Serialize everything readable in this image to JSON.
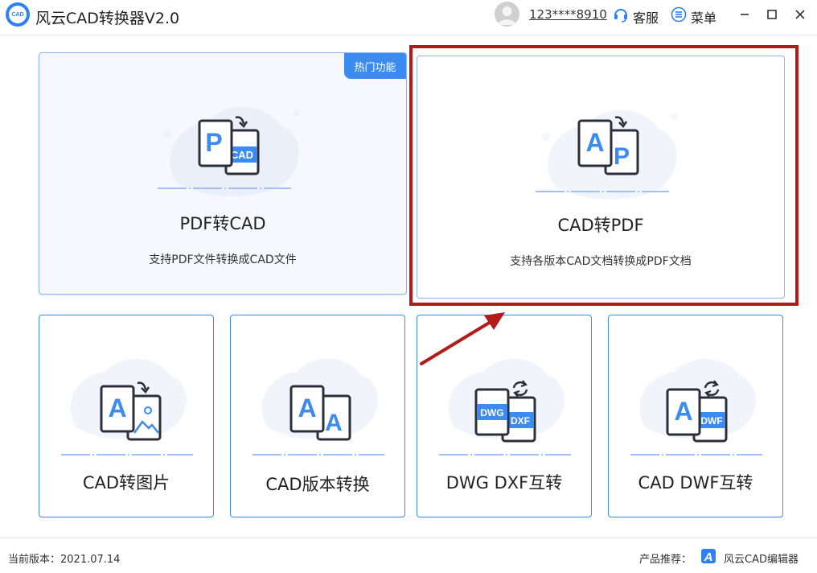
{
  "window": {
    "title": "风云CAD转换器V2.0",
    "logo_text": "CAD"
  },
  "header": {
    "user_phone": "123****8910",
    "service_label": "客服",
    "menu_label": "菜单"
  },
  "features": {
    "pdf_to_cad": {
      "title": "PDF转CAD",
      "description": "支持PDF文件转换成CAD文件",
      "badge": "热门功能",
      "icon_front": "P",
      "icon_back": "CAD"
    },
    "cad_to_pdf": {
      "title": "CAD转PDF",
      "description": "支持各版本CAD文档转换成PDF文档",
      "icon_front": "A",
      "icon_back": "P"
    },
    "cad_to_image": {
      "title": "CAD转图片",
      "icon_front": "A"
    },
    "cad_version": {
      "title": "CAD版本转换",
      "icon_front": "A",
      "icon_back": "A"
    },
    "dwg_dxf": {
      "title": "DWG DXF互转",
      "icon_front": "DWG",
      "icon_back": "DXF"
    },
    "cad_dwf": {
      "title": "CAD DWF互转",
      "icon_front": "A",
      "icon_back": "DWF"
    }
  },
  "footer": {
    "version": "当前版本：2021.07.14",
    "recommend_label": "产品推荐：",
    "recommend_product": "风云CAD编辑器"
  },
  "colors": {
    "accent": "#3c8bf0",
    "highlight": "#b31b1b",
    "icon_dark": "#2b2f3a"
  }
}
